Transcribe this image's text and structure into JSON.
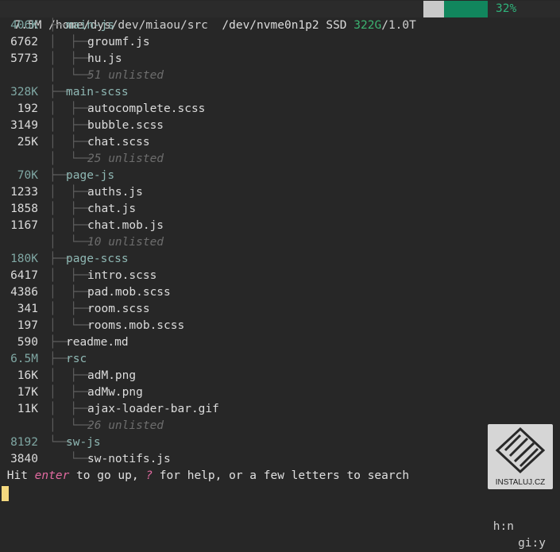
{
  "header": {
    "dir_size": "7.5M",
    "path": "/home/dys/dev/miaou/src",
    "device": "/dev/nvme0n1p2",
    "disk_type": "SSD",
    "used": "322G",
    "total": "1.0T",
    "usage_percent": "32%",
    "usage_fraction": 0.32
  },
  "tree": [
    {
      "size": "406K",
      "name": "main-js",
      "kind": "dir",
      "depth": 0,
      "last": false
    },
    {
      "size": "6762",
      "name": "groumf.js",
      "kind": "file",
      "depth": 1,
      "last": false
    },
    {
      "size": "5773",
      "name": "hu.js",
      "kind": "file",
      "depth": 1,
      "last": false
    },
    {
      "size": "",
      "name": "51 unlisted",
      "kind": "unlisted",
      "depth": 1,
      "last": true
    },
    {
      "size": "328K",
      "name": "main-scss",
      "kind": "dir",
      "depth": 0,
      "last": false
    },
    {
      "size": "192",
      "name": "autocomplete.scss",
      "kind": "file",
      "depth": 1,
      "last": false
    },
    {
      "size": "3149",
      "name": "bubble.scss",
      "kind": "file",
      "depth": 1,
      "last": false
    },
    {
      "size": "25K",
      "name": "chat.scss",
      "kind": "file",
      "depth": 1,
      "last": false
    },
    {
      "size": "",
      "name": "25 unlisted",
      "kind": "unlisted",
      "depth": 1,
      "last": true
    },
    {
      "size": "70K",
      "name": "page-js",
      "kind": "dir",
      "depth": 0,
      "last": false
    },
    {
      "size": "1233",
      "name": "auths.js",
      "kind": "file",
      "depth": 1,
      "last": false
    },
    {
      "size": "1858",
      "name": "chat.js",
      "kind": "file",
      "depth": 1,
      "last": false
    },
    {
      "size": "1167",
      "name": "chat.mob.js",
      "kind": "file",
      "depth": 1,
      "last": false
    },
    {
      "size": "",
      "name": "10 unlisted",
      "kind": "unlisted",
      "depth": 1,
      "last": true
    },
    {
      "size": "180K",
      "name": "page-scss",
      "kind": "dir",
      "depth": 0,
      "last": false
    },
    {
      "size": "6417",
      "name": "intro.scss",
      "kind": "file",
      "depth": 1,
      "last": false
    },
    {
      "size": "4386",
      "name": "pad.mob.scss",
      "kind": "file",
      "depth": 1,
      "last": false
    },
    {
      "size": "341",
      "name": "room.scss",
      "kind": "file",
      "depth": 1,
      "last": false
    },
    {
      "size": "197",
      "name": "rooms.mob.scss",
      "kind": "file",
      "depth": 1,
      "last": true
    },
    {
      "size": "590",
      "name": "readme.md",
      "kind": "file",
      "depth": 0,
      "last": false
    },
    {
      "size": "6.5M",
      "name": "rsc",
      "kind": "dir",
      "depth": 0,
      "last": false
    },
    {
      "size": "16K",
      "name": "adM.png",
      "kind": "file",
      "depth": 1,
      "last": false
    },
    {
      "size": "17K",
      "name": "adMw.png",
      "kind": "file",
      "depth": 1,
      "last": false
    },
    {
      "size": "11K",
      "name": "ajax-loader-bar.gif",
      "kind": "file",
      "depth": 1,
      "last": false
    },
    {
      "size": "",
      "name": "26 unlisted",
      "kind": "unlisted",
      "depth": 1,
      "last": true
    },
    {
      "size": "8192",
      "name": "sw-js",
      "kind": "dir",
      "depth": 0,
      "last": true
    },
    {
      "size": "3840",
      "name": "sw-notifs.js",
      "kind": "file",
      "depth": 1,
      "last": true
    }
  ],
  "status": {
    "prefix": "Hit ",
    "key1": "enter",
    "mid": " to go up, ",
    "key2": "?",
    "suffix": " for help, or a few letters to search"
  },
  "input_line": {
    "hint_hidden": "h:n",
    "hint_git": "gi:y"
  },
  "watermark": {
    "text": "INSTALUJ.CZ"
  }
}
